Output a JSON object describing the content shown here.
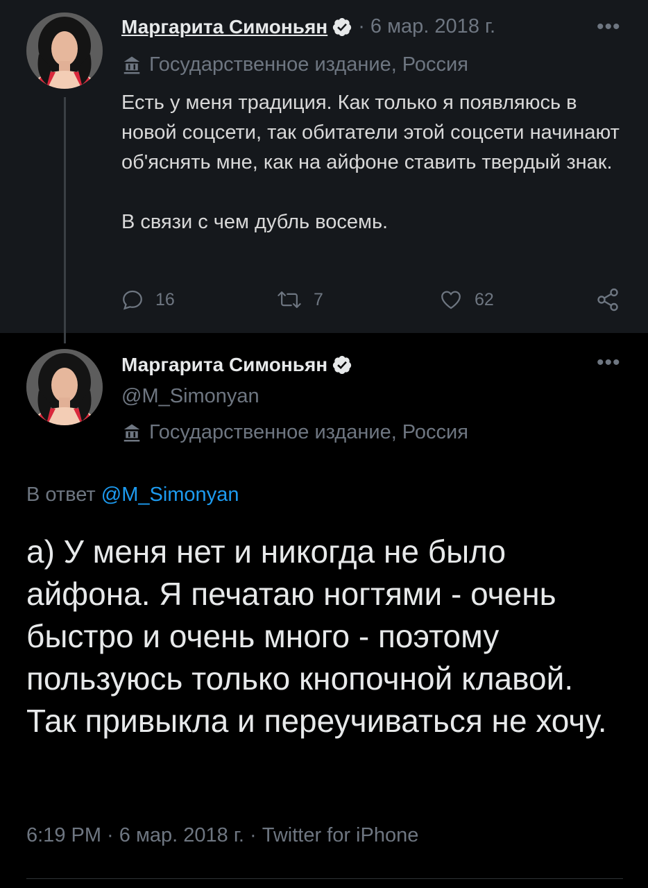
{
  "parent_tweet": {
    "author_name": "Маргарита Симоньян",
    "date_separator": "· 6 мар. 2018 г.",
    "affiliation_label": "Государственное издание, Россия",
    "text_paragraphs": [
      "Есть у меня традиция. Как только я появляюсь в новой соцсети, так обитатели этой соцсети начинают об'яснять мне, как на айфоне ставить твердый знак.",
      "В связи с чем дубль восемь."
    ],
    "replies_count": "16",
    "retweets_count": "7",
    "likes_count": "62"
  },
  "focal_tweet": {
    "author_name": "Маргарита Симоньян",
    "handle": "@M_Simonyan",
    "affiliation_label": "Государственное издание, Россия",
    "reply_prefix": "В ответ",
    "reply_to_handle": "@M_Simonyan",
    "text": "а) У меня нет и никогда не было айфона. Я печатаю ногтями - очень быстро и очень много - поэтому пользуюсь только кнопочной клавой. Так привыкла и переучиваться не хочу.",
    "meta": "6:19 PM · 6 мар. 2018 г. · Twitter for iPhone"
  },
  "icons": {
    "verified": "verified-badge-icon",
    "more": "more-dots-icon",
    "government": "government-building-icon",
    "reply": "reply-bubble-icon",
    "retweet": "retweet-icon",
    "like": "heart-icon",
    "share": "share-icon"
  },
  "colors": {
    "background": "#000000",
    "parent_background": "#15181c",
    "text": "#e7e9ea",
    "muted": "#6e7681",
    "link": "#1d9bf0"
  }
}
